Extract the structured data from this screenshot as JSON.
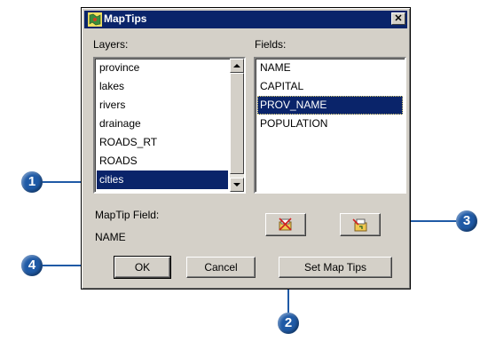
{
  "dialog": {
    "title": "MapTips",
    "close_label": "✕"
  },
  "layers": {
    "label": "Layers:",
    "items": [
      "province",
      "lakes",
      "rivers",
      "drainage",
      "ROADS_RT",
      "ROADS",
      "cities"
    ],
    "selected": "cities"
  },
  "fields": {
    "label": "Fields:",
    "items": [
      "NAME",
      "CAPITAL",
      "PROV_NAME",
      "POPULATION"
    ],
    "selected": "PROV_NAME"
  },
  "maptip_field": {
    "label": "MapTip Field:",
    "value": "NAME"
  },
  "buttons": {
    "ok": "OK",
    "cancel": "Cancel",
    "set_map_tips": "Set Map Tips"
  },
  "icons": {
    "clear_maptip": "clear-maptip-icon",
    "set_maptip": "set-maptip-icon"
  },
  "callouts": [
    "1",
    "2",
    "3",
    "4"
  ],
  "colors": {
    "dialog_bg": "#d4d0c8",
    "title_bar": "#0a246a",
    "selection": "#0a246a",
    "callout": "#1f5aa6"
  }
}
